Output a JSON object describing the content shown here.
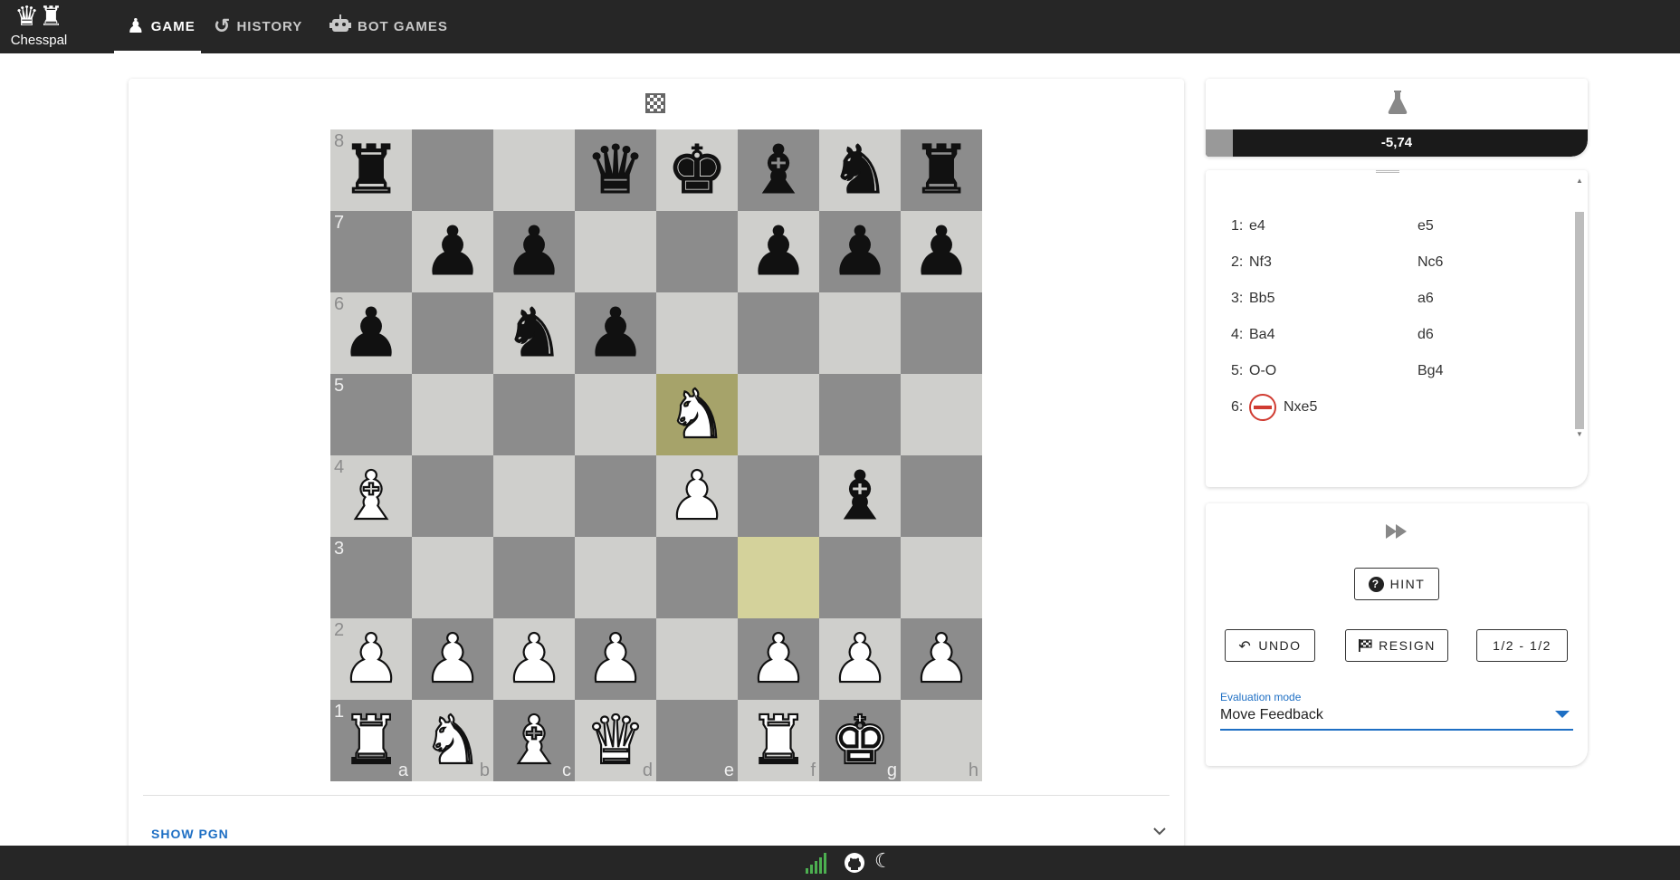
{
  "app": {
    "name": "Chesspal",
    "logo_glyph": "♛♜"
  },
  "nav": {
    "tabs": [
      {
        "label": "GAME",
        "icon": "pawn-icon",
        "glyph": "♟",
        "active": true
      },
      {
        "label": "HISTORY",
        "icon": "history-icon",
        "glyph": "↺",
        "active": false
      },
      {
        "label": "BOT GAMES",
        "icon": "robot-icon",
        "glyph": "🤖",
        "active": false
      }
    ]
  },
  "board": {
    "flip_icon": "checkerboard-icon",
    "ranks": [
      "8",
      "7",
      "6",
      "5",
      "4",
      "3",
      "2",
      "1"
    ],
    "files": [
      "a",
      "b",
      "c",
      "d",
      "e",
      "f",
      "g",
      "h"
    ],
    "position": [
      [
        "r",
        "",
        "",
        "q",
        "k",
        "b",
        "n",
        "r"
      ],
      [
        "",
        "p",
        "p",
        "",
        "",
        "p",
        "p",
        "p"
      ],
      [
        "p",
        "",
        "n",
        "p",
        "",
        "",
        "",
        ""
      ],
      [
        "",
        "",
        "",
        "",
        "N",
        "",
        "",
        ""
      ],
      [
        "B",
        "",
        "",
        "",
        "P",
        "",
        "b",
        ""
      ],
      [
        "",
        "",
        "",
        "",
        "",
        "",
        "",
        ""
      ],
      [
        "P",
        "P",
        "P",
        "P",
        "",
        "P",
        "P",
        "P"
      ],
      [
        "R",
        "N",
        "B",
        "Q",
        "",
        "R",
        "K",
        ""
      ]
    ],
    "last_move": {
      "from": "f3",
      "to": "e5"
    }
  },
  "pgn": {
    "toggle_label": "SHOW PGN"
  },
  "evaluation": {
    "icon": "flask-icon",
    "score": "-5,74",
    "white_share": 0.072
  },
  "moves": [
    {
      "number": "1:",
      "white": "e4",
      "black": "e5",
      "blunder": false
    },
    {
      "number": "2:",
      "white": "Nf3",
      "black": "Nc6",
      "blunder": false
    },
    {
      "number": "3:",
      "white": "Bb5",
      "black": "a6",
      "blunder": false
    },
    {
      "number": "4:",
      "white": "Ba4",
      "black": "d6",
      "blunder": false
    },
    {
      "number": "5:",
      "white": "O-O",
      "black": "Bg4",
      "blunder": false
    },
    {
      "number": "6:",
      "white": "Nxe5",
      "black": "",
      "blunder": true
    }
  ],
  "controls": {
    "fast_forward_icon": "fast-forward-icon",
    "hint_label": "HINT",
    "undo_label": "UNDO",
    "resign_label": "RESIGN",
    "draw_label": "1/2 - 1/2",
    "eval_mode_label": "Evaluation mode",
    "eval_mode_value": "Move Feedback"
  },
  "footer": {
    "icons": [
      "signal-icon",
      "github-icon",
      "moon-icon"
    ],
    "signal_color": "#4caf50"
  },
  "colors": {
    "topbar": "#262626",
    "board_light": "#cfcfcc",
    "board_dark": "#8c8c8c",
    "highlight_to": "#a6a36a",
    "highlight_from": "#d4d29b",
    "accent": "#1e6fc4",
    "blunder": "#d03c32"
  }
}
